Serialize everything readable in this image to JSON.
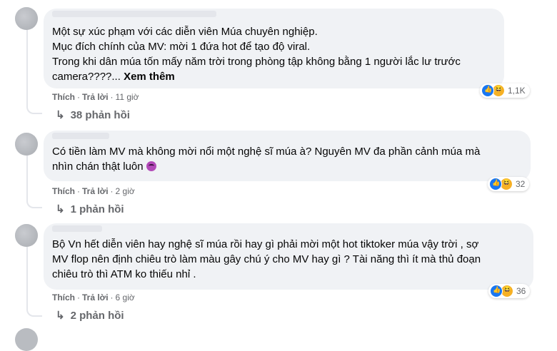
{
  "comments": [
    {
      "lines": [
        "Một sự xúc phạm với các diễn viên Múa chuyên nghiệp.",
        "Mục đích chính của MV: mời 1 đứa hot để tạo độ viral.",
        "Trong khi dân múa tốn mấy năm trời trong phòng tập không bằng 1 người lắc lư trước",
        "camera????..."
      ],
      "see_more": "Xem thêm",
      "like": "Thích",
      "reply": "Trả lời",
      "time": "11 giờ",
      "reaction_count": "1,1K",
      "replies": "38 phản hồi"
    },
    {
      "lines": [
        "Có tiền làm MV mà không mời nổi một nghệ sĩ múa à? Nguyên MV đa phần cảnh múa mà",
        "nhìn chán thật luôn"
      ],
      "emoji": "tired-face-emoji",
      "like": "Thích",
      "reply": "Trả lời",
      "time": "2 giờ",
      "reaction_count": "32",
      "replies": "1 phản hồi"
    },
    {
      "lines": [
        "Bộ Vn hết diễn viên hay nghệ sĩ múa rồi hay gì phải mời một hot tiktoker múa vậy trời , sợ",
        "MV flop nên định chiêu trò làm màu gây chú ý cho MV hay gì ? Tài năng thì ít mà thủ đoạn",
        "chiêu trò thì ATM ko thiếu nhỉ ."
      ],
      "like": "Thích",
      "reply": "Trả lời",
      "time": "6 giờ",
      "reaction_count": "36",
      "replies": "2 phản hồi"
    }
  ],
  "icons": {
    "reaction_like": "like-icon",
    "reaction_haha": "haha-icon",
    "reply_arrow": "reply-arrow-icon"
  },
  "colors": {
    "bubble": "#f0f2f5",
    "meta_text": "#65676b",
    "like_blue": "#1877f2"
  }
}
